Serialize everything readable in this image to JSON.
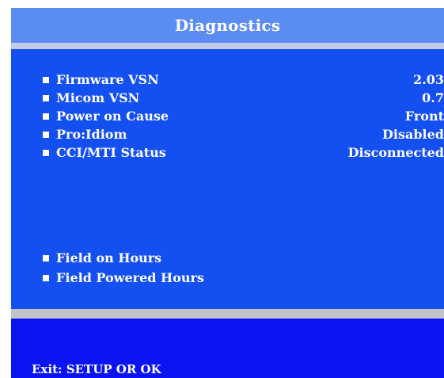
{
  "title": "Diagnostics",
  "colors": {
    "title_bar": "#5b8cf2",
    "panel": "#1450f0",
    "footer": "#0a14f0",
    "separator": "#c3c3c8",
    "text": "#ffffff"
  },
  "items": [
    {
      "label": "Firmware VSN",
      "value": "2.03"
    },
    {
      "label": "Micom VSN",
      "value": "0.7"
    },
    {
      "label": "Power on Cause",
      "value": "Front"
    },
    {
      "label": "Pro:Idiom",
      "value": "Disabled"
    },
    {
      "label": "CCI/MTI Status",
      "value": "Disconnected"
    }
  ],
  "hours": [
    {
      "label": "Field on Hours",
      "value": ""
    },
    {
      "label": "Field Powered Hours",
      "value": ""
    }
  ],
  "footer": {
    "hint": "Exit:  SETUP OR OK"
  }
}
